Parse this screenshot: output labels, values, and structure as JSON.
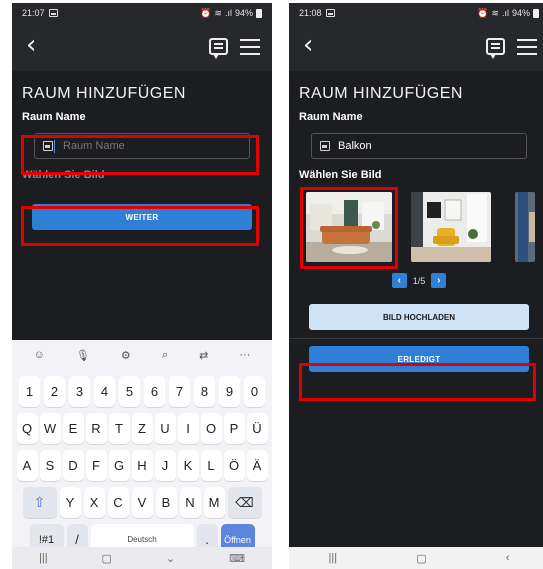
{
  "left_screen": {
    "status": {
      "time": "21:07",
      "battery": "94%"
    },
    "title": "RAUM HINZUFÜGEN",
    "room_name_label": "Raum Name",
    "room_name_placeholder": "Raum Name",
    "choose_image_label": "Wählen Sie Bild",
    "next_button": "WEITER",
    "keyboard": {
      "row1": [
        "1",
        "2",
        "3",
        "4",
        "5",
        "6",
        "7",
        "8",
        "9",
        "0"
      ],
      "row2": [
        "Q",
        "W",
        "E",
        "R",
        "T",
        "Z",
        "U",
        "I",
        "O",
        "P",
        "Ü"
      ],
      "row3": [
        "A",
        "S",
        "D",
        "F",
        "G",
        "H",
        "J",
        "K",
        "L",
        "Ö",
        "Ä"
      ],
      "row4": [
        "Y",
        "X",
        "C",
        "V",
        "B",
        "N",
        "M"
      ],
      "symbols_key": "!#1",
      "slash_key": "/",
      "space_label": "Deutsch",
      "period_key": ".",
      "go_key": "Öffnen"
    }
  },
  "right_screen": {
    "status": {
      "time": "21:08",
      "battery": "94%"
    },
    "title": "RAUM HINZUFÜGEN",
    "room_name_label": "Raum Name",
    "room_name_value": "Balkon",
    "choose_image_label": "Wählen Sie Bild",
    "pager_text": "1/5",
    "upload_button": "BILD HOCHLADEN",
    "done_button": "ERLEDIGT"
  },
  "colors": {
    "accent": "#2f7fd6",
    "highlight": "#e10000",
    "background": "#1c1d20"
  }
}
